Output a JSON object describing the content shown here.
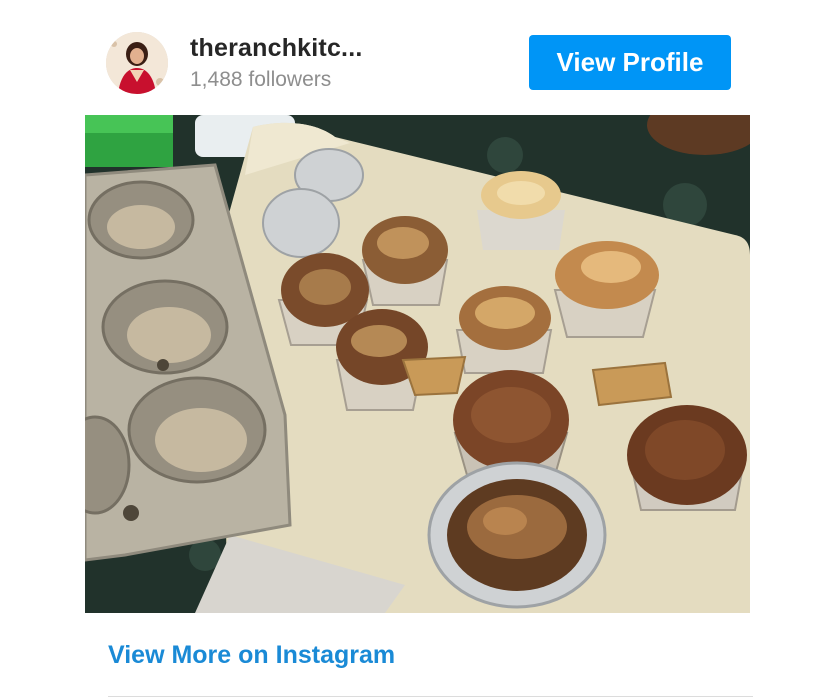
{
  "profile": {
    "username": "theranchkitc...",
    "followers": "1,488 followers",
    "avatar_icon": "profile-avatar"
  },
  "actions": {
    "view_profile_label": "View Profile",
    "view_more_label": "View More on Instagram"
  },
  "colors": {
    "accent": "#0095f6",
    "link": "#1a8ad6",
    "username": "#262626",
    "muted": "#8e8e8e"
  }
}
